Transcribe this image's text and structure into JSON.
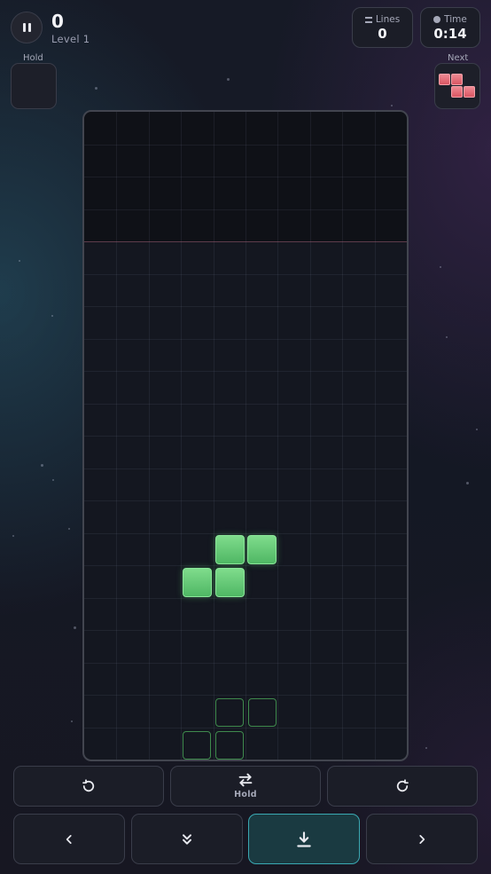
{
  "header": {
    "score": "0",
    "level": "Level 1",
    "lines": {
      "label": "Lines",
      "value": "0",
      "icon": "lines-icon"
    },
    "time": {
      "label": "Time",
      "value": "0:14",
      "icon": "timer-icon"
    },
    "pause_icon": "pause-icon"
  },
  "hold": {
    "label": "Hold",
    "piece": null
  },
  "next": {
    "label": "Next",
    "piece": "Z",
    "color": "#e36b76"
  },
  "board": {
    "columns": 10,
    "rows": 20,
    "active_piece": {
      "type": "S",
      "color": "#5fc872"
    },
    "ghost_color": "#3f8a4d"
  },
  "controls": {
    "rotate_left_icon": "rotate-ccw-icon",
    "hold_label": "Hold",
    "hold_icon": "swap-icon",
    "rotate_right_icon": "rotate-cw-icon",
    "move_left_icon": "chevron-left-icon",
    "soft_drop_icon": "double-chevron-down-icon",
    "hard_drop_icon": "hard-drop-icon",
    "move_right_icon": "chevron-right-icon",
    "accent": "#3aa9b3"
  }
}
